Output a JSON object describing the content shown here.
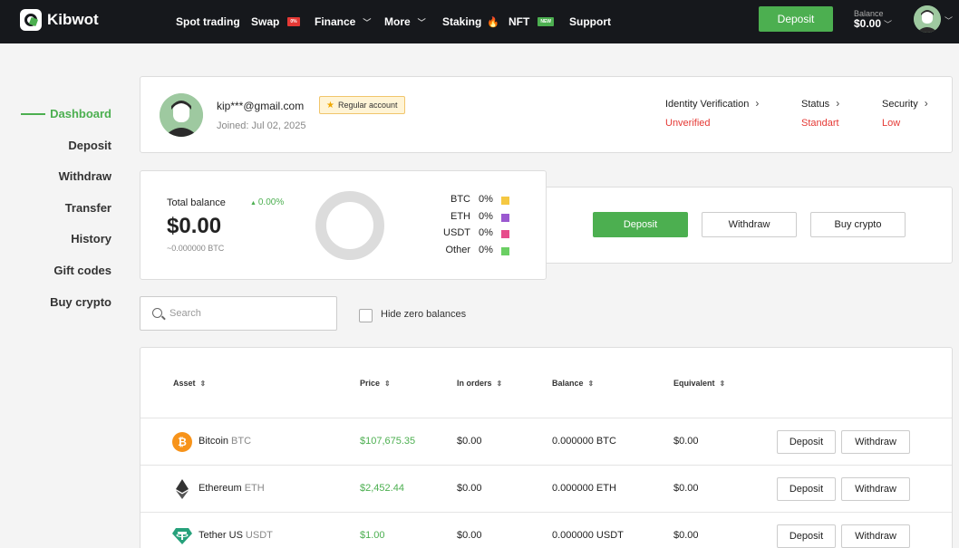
{
  "brand": {
    "name": "Kibwot"
  },
  "nav": {
    "spot": "Spot trading",
    "swap": "Swap",
    "swap_badge": "0%",
    "finance": "Finance",
    "more": "More",
    "staking": "Staking",
    "nft": "NFT",
    "nft_badge": "NEW",
    "support": "Support"
  },
  "header": {
    "deposit_label": "Deposit",
    "balance_label": "Balance",
    "balance_value": "$0.00"
  },
  "sidebar": {
    "items": [
      "Dashboard",
      "Deposit",
      "Withdraw",
      "Transfer",
      "History",
      "Gift codes",
      "Buy crypto"
    ]
  },
  "profile": {
    "email": "kip***@gmail.com",
    "joined": "Joined: Jul 02, 2025",
    "account_type": "Regular account",
    "identity_label": "Identity Verification",
    "identity_value": "Unverified",
    "status_label": "Status",
    "status_value": "Standart",
    "security_label": "Security",
    "security_value": "Low"
  },
  "balance": {
    "label": "Total balance",
    "change": "0.00%",
    "value": "$0.00",
    "btc_equiv": "~0.000000 BTC",
    "legend": [
      {
        "name": "BTC",
        "pct": "0%",
        "color": "#f5c842"
      },
      {
        "name": "ETH",
        "pct": "0%",
        "color": "#9b59d0"
      },
      {
        "name": "USDT",
        "pct": "0%",
        "color": "#e74c8c"
      },
      {
        "name": "Other",
        "pct": "0%",
        "color": "#6bcf63"
      }
    ],
    "deposit": "Deposit",
    "withdraw": "Withdraw",
    "buy": "Buy crypto"
  },
  "filters": {
    "search_placeholder": "Search",
    "hide_zero": "Hide zero balances"
  },
  "table": {
    "headers": [
      "Asset",
      "Price",
      "In orders",
      "Balance",
      "Equivalent"
    ],
    "deposit_label": "Deposit",
    "withdraw_label": "Withdraw",
    "rows": [
      {
        "name": "Bitcoin",
        "symbol": "BTC",
        "price": "$107,675.35",
        "in_orders": "$0.00",
        "balance": "0.000000 BTC",
        "equivalent": "$0.00"
      },
      {
        "name": "Ethereum",
        "symbol": "ETH",
        "price": "$2,452.44",
        "in_orders": "$0.00",
        "balance": "0.000000 ETH",
        "equivalent": "$0.00"
      },
      {
        "name": "Tether US",
        "symbol": "USDT",
        "price": "$1.00",
        "in_orders": "$0.00",
        "balance": "0.000000 USDT",
        "equivalent": "$0.00"
      }
    ]
  },
  "colors": {
    "accent": "#4caf50",
    "danger": "#e53935",
    "nav_bg": "#16181c"
  }
}
